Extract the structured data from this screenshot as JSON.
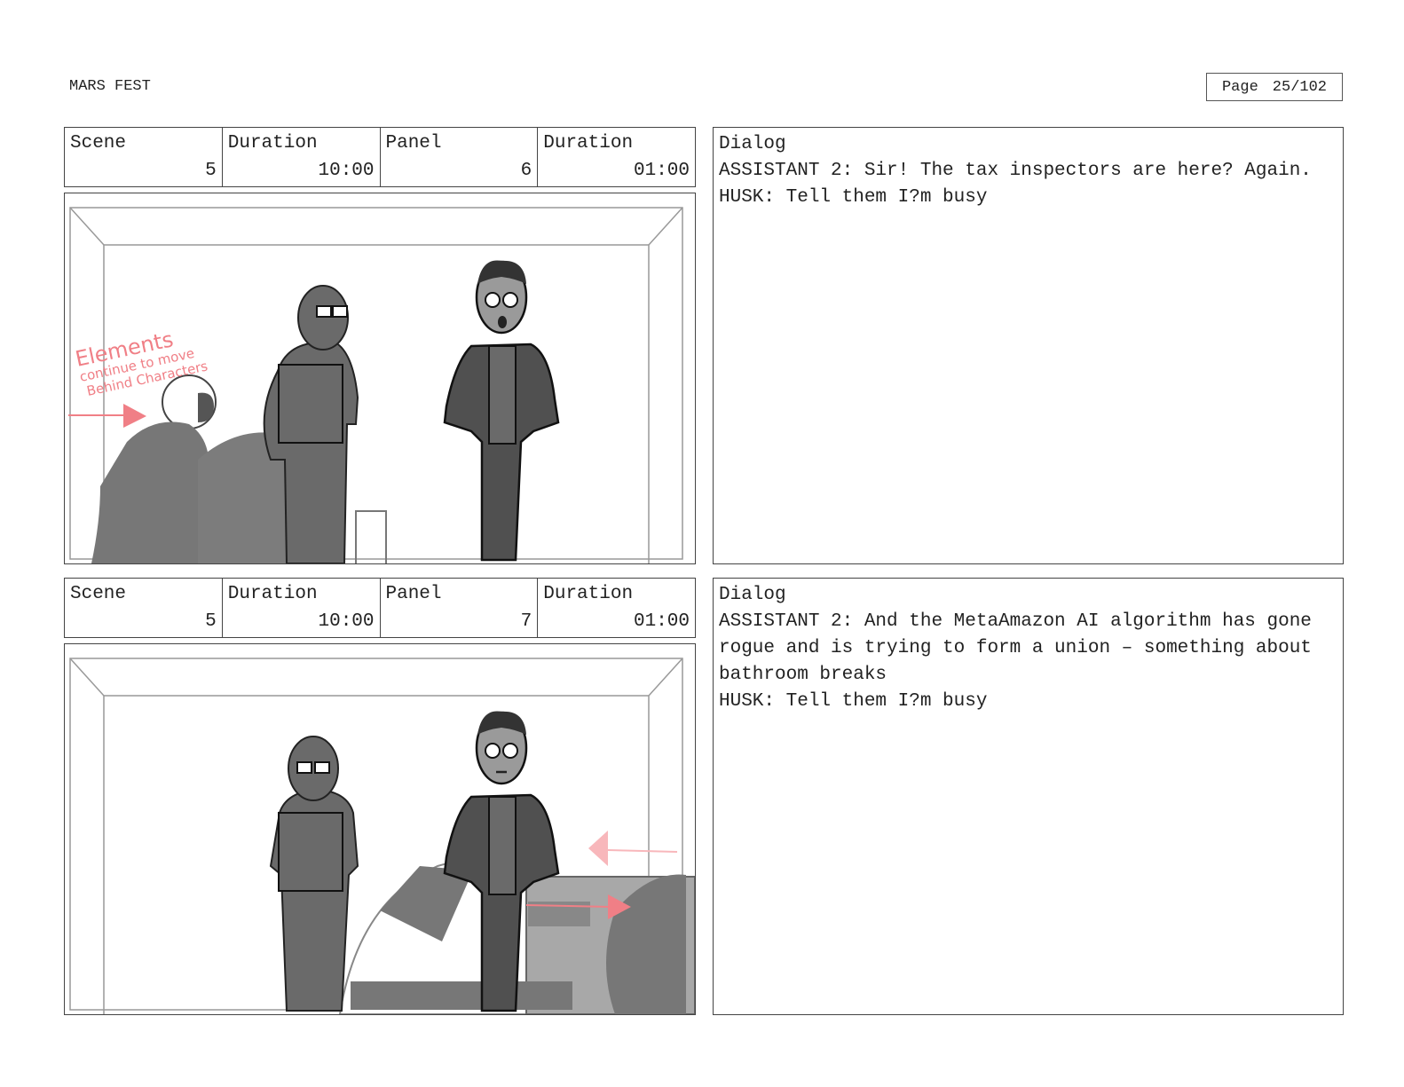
{
  "header": {
    "title": "MARS FEST",
    "page_label": "Page",
    "page_value": "25/102"
  },
  "rows": [
    {
      "scene_label": "Scene",
      "scene_value": "5",
      "scene_duration_label": "Duration",
      "scene_duration_value": "10:00",
      "panel_label": "Panel",
      "panel_value": "6",
      "panel_duration_label": "Duration",
      "panel_duration_value": "01:00",
      "dialog_label": "Dialog",
      "dialog_lines": [
        "ASSISTANT 2: Sir! The tax inspectors are here? Again.",
        "HUSK: Tell them I?m busy"
      ],
      "note_lines": [
        "Elements",
        "continue to move",
        "Behind Characters"
      ]
    },
    {
      "scene_label": "Scene",
      "scene_value": "5",
      "scene_duration_label": "Duration",
      "scene_duration_value": "10:00",
      "panel_label": "Panel",
      "panel_value": "7",
      "panel_duration_label": "Duration",
      "panel_duration_value": "01:00",
      "dialog_label": "Dialog",
      "dialog_lines": [
        "ASSISTANT 2: And the MetaAmazon AI algorithm has gone rogue and is trying to form a union – something about bathroom breaks",
        "HUSK: Tell them I?m busy"
      ]
    }
  ],
  "colors": {
    "annotation": "#f07f86",
    "figure": "#6a6a6a",
    "border": "#444444"
  }
}
